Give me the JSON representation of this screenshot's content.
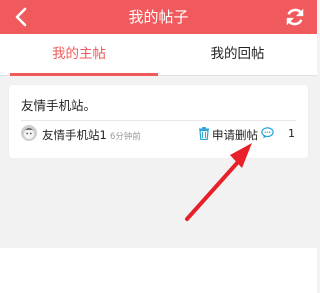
{
  "header": {
    "title": "我的帖子",
    "back_icon": "back-chevron-icon",
    "refresh_icon": "refresh-icon",
    "bar_color": "#f15a5d"
  },
  "tabs": [
    {
      "label": "我的主帖",
      "active": true
    },
    {
      "label": "我的回帖",
      "active": false
    }
  ],
  "post": {
    "title": "友情手机站。",
    "author": "友情手机站1",
    "time": "6分钟前",
    "delete_label": "申请删帖",
    "comment_count": "1"
  },
  "colors": {
    "accent": "#f15a5d",
    "icon_teal": "#29a3d6",
    "annotation_arrow": "#e8202a"
  }
}
